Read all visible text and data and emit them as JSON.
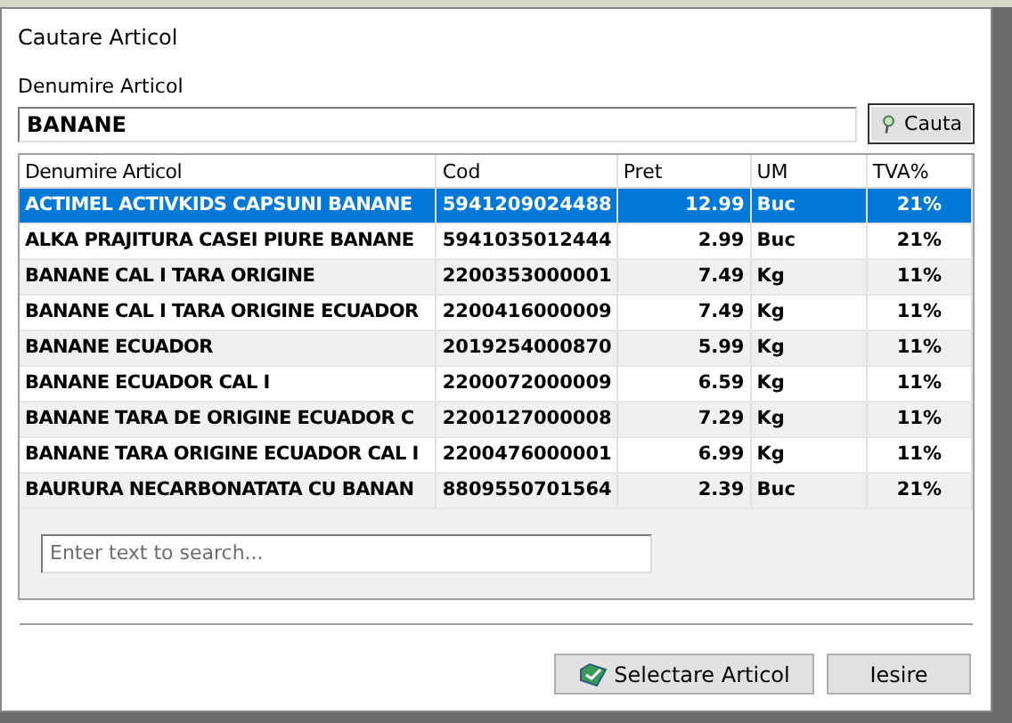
{
  "window": {
    "title": "Cautare Articol"
  },
  "search": {
    "label": "Denumire Articol",
    "value": "BANANE",
    "button": "Cauta"
  },
  "table": {
    "columns": [
      "Denumire Articol",
      "Cod",
      "Pret",
      "UM",
      "TVA%"
    ],
    "rows": [
      {
        "cells": [
          "ACTIMEL ACTIVKIDS CAPSUNI BANANE",
          "5941209024488",
          "12.99",
          "Buc",
          "21%"
        ],
        "selected": true
      },
      {
        "cells": [
          "ALKA PRAJITURA CASEI PIURE BANANE",
          "5941035012444",
          "2.99",
          "Buc",
          "21%"
        ],
        "selected": false
      },
      {
        "cells": [
          "BANANE CAL I TARA ORIGINE",
          "2200353000001",
          "7.49",
          "Kg",
          "11%"
        ],
        "selected": false
      },
      {
        "cells": [
          "BANANE CAL I TARA ORIGINE ECUADOR",
          "2200416000009",
          "7.49",
          "Kg",
          "11%"
        ],
        "selected": false
      },
      {
        "cells": [
          "BANANE ECUADOR",
          "2019254000870",
          "5.99",
          "Kg",
          "11%"
        ],
        "selected": false
      },
      {
        "cells": [
          "BANANE ECUADOR CAL I",
          "2200072000009",
          "6.59",
          "Kg",
          "11%"
        ],
        "selected": false
      },
      {
        "cells": [
          "BANANE TARA DE ORIGINE ECUADOR C",
          "2200127000008",
          "7.29",
          "Kg",
          "11%"
        ],
        "selected": false
      },
      {
        "cells": [
          "BANANE TARA ORIGINE ECUADOR CAL I",
          "2200476000001",
          "6.99",
          "Kg",
          "11%"
        ],
        "selected": false
      },
      {
        "cells": [
          "BAURURA NECARBONATATA CU BANAN",
          "8809550701564",
          "2.39",
          "Buc",
          "21%"
        ],
        "selected": false
      }
    ]
  },
  "filter": {
    "placeholder": "Enter text to search..."
  },
  "buttons": [
    {
      "label": "Selectare Articol",
      "kind": "select"
    },
    {
      "label": "Iesire",
      "kind": "exit"
    }
  ]
}
